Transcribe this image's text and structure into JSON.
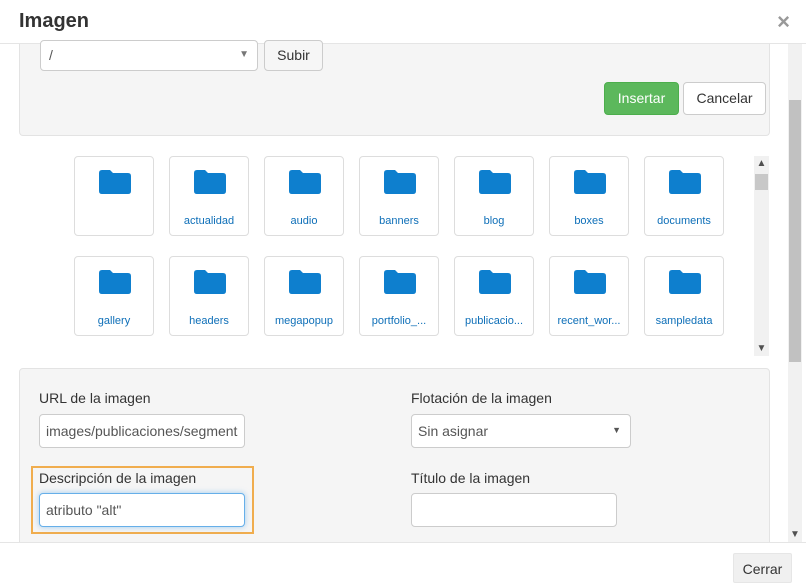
{
  "header": {
    "title": "Imagen",
    "close_glyph": "×"
  },
  "toolbar": {
    "folder_value": "/",
    "upload_label": "Subir",
    "insert_label": "Insertar",
    "cancel_label": "Cancelar"
  },
  "browser": {
    "folders": [
      {
        "name": ""
      },
      {
        "name": "actualidad"
      },
      {
        "name": "audio"
      },
      {
        "name": "banners"
      },
      {
        "name": "blog"
      },
      {
        "name": "boxes"
      },
      {
        "name": "documents"
      },
      {
        "name": "gallery"
      },
      {
        "name": "headers"
      },
      {
        "name": "megapopup"
      },
      {
        "name": "portfolio_..."
      },
      {
        "name": "publicacio..."
      },
      {
        "name": "recent_wor..."
      },
      {
        "name": "sampledata"
      }
    ]
  },
  "fields": {
    "url_label": "URL de la imagen",
    "url_value": "images/publicaciones/segment",
    "float_label": "Flotación de la imagen",
    "float_value": "Sin asignar",
    "desc_label": "Descripción de la imagen",
    "desc_value": "atributo \"alt\"",
    "title_label": "Título de la imagen",
    "title_value": ""
  },
  "footer": {
    "close_label": "Cerrar"
  },
  "colors": {
    "accent_insert": "#5cb85c",
    "folder_icon": "#0e7fce",
    "highlight": "#f0ad4e"
  }
}
